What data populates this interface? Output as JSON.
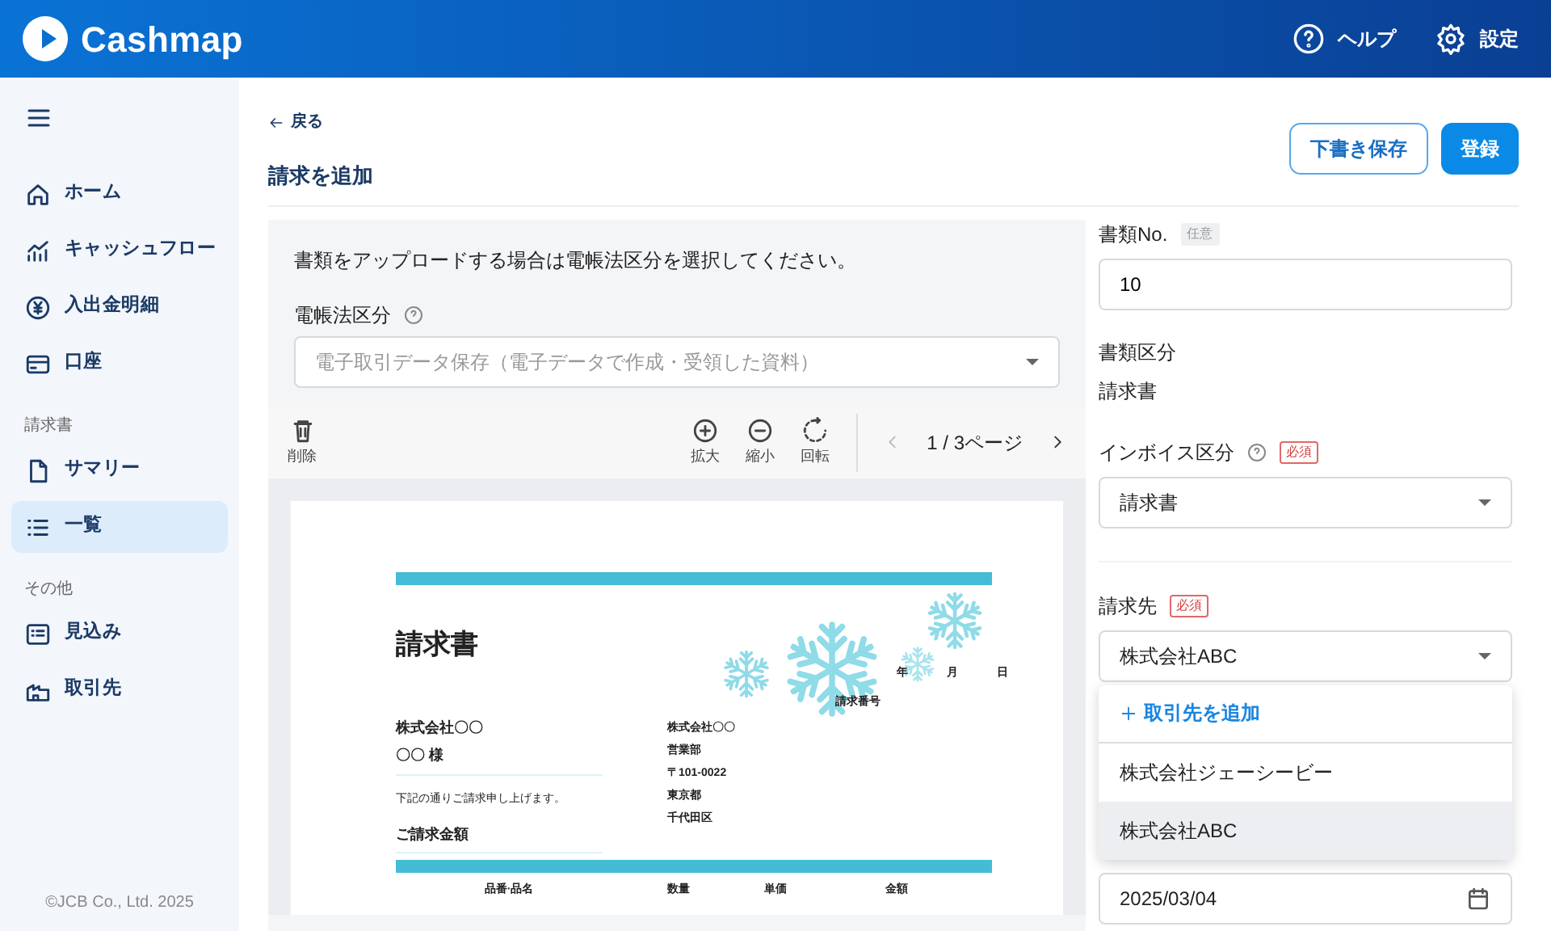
{
  "header": {
    "logo": "Cashmap",
    "help": "ヘルプ",
    "settings": "設定"
  },
  "sidebar": {
    "items": [
      {
        "kind": "item",
        "label": "ホーム",
        "selected": false
      },
      {
        "kind": "item",
        "label": "キャッシュフロー",
        "selected": false
      },
      {
        "kind": "item",
        "label": "入出金明細",
        "selected": false
      },
      {
        "kind": "item",
        "label": "口座",
        "selected": false
      },
      {
        "kind": "heading",
        "label": "請求書"
      },
      {
        "kind": "item",
        "label": "サマリー",
        "selected": false
      },
      {
        "kind": "item",
        "label": "一覧",
        "selected": true
      },
      {
        "kind": "heading",
        "label": "その他"
      },
      {
        "kind": "item",
        "label": "見込み",
        "selected": false
      },
      {
        "kind": "item",
        "label": "取引先",
        "selected": false
      }
    ],
    "copyright": "©JCB Co., Ltd. 2025"
  },
  "page": {
    "back": "戻る",
    "title": "請求を追加",
    "buttons": [
      {
        "label": "下書き保存",
        "kind": "outline"
      },
      {
        "label": "登録",
        "kind": "primary"
      }
    ]
  },
  "upload": {
    "notice": "書類をアップロードする場合は電帳法区分を選択してください。",
    "label": "電帳法区分",
    "placeholder": "電子取引データ保存（電子データで作成・受領した資料）"
  },
  "toolbar": {
    "tools": [
      {
        "kind": "delete",
        "label": "削除"
      },
      {
        "kind": "zoom-in",
        "label": "拡大"
      },
      {
        "kind": "zoom-out",
        "label": "縮小"
      },
      {
        "kind": "rotate",
        "label": "回転"
      }
    ],
    "prev_disabled": true,
    "page_indicator": "1 / 3ページ"
  },
  "document": {
    "title": "請求書",
    "date_labels": [
      "年",
      "月",
      "日"
    ],
    "number_label": "請求番号",
    "recipient_company": "株式会社〇〇",
    "recipient_name": "〇〇 様",
    "message": "下記の通りご請求申し上げます。",
    "amount_label": "ご請求金額",
    "issuer_lines": [
      "株式会社〇〇",
      "営業部",
      "〒101-0022",
      "東京都",
      "千代田区"
    ],
    "columns": [
      "品番·品名",
      "数量",
      "単価",
      "金額"
    ]
  },
  "form": {
    "doc_number": {
      "label": "書類No.",
      "badge": {
        "kind": "optional",
        "text": "任意"
      },
      "value": "10"
    },
    "doc_type": {
      "label": "書類区分",
      "value": "請求書"
    },
    "invoice_type": {
      "label": "インボイス区分",
      "badge": {
        "kind": "required",
        "text": "必須"
      },
      "value": "請求書"
    },
    "billing_to": {
      "label": "請求先",
      "badge": {
        "kind": "required",
        "text": "必須"
      },
      "value": "株式会社ABC",
      "expanded": true,
      "menu": {
        "add": "取引先を追加",
        "options": [
          {
            "label": "株式会社ジェーシービー",
            "selected": false
          },
          {
            "label": "株式会社ABC",
            "selected": true
          }
        ]
      }
    },
    "date": {
      "value": "2025/03/04"
    }
  }
}
